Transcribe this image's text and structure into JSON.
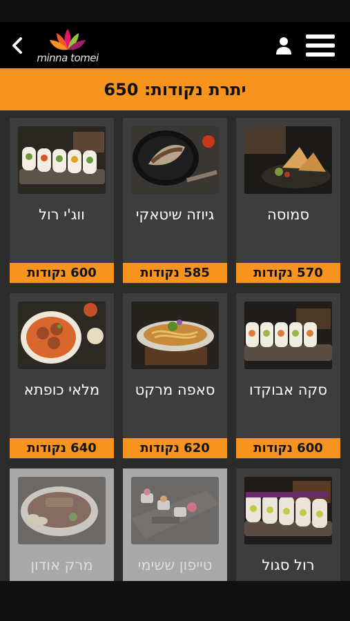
{
  "header": {
    "back_icon": "chevron-left-icon",
    "logo_text": "minna tomei",
    "profile_icon": "user-icon",
    "menu_icon": "hamburger-menu-icon"
  },
  "points": {
    "label": "יתרת נקודות: 650"
  },
  "items": [
    {
      "name": "סמוסה",
      "price": "570 נקודות",
      "available": true,
      "dish": "samosa"
    },
    {
      "name": "גיוזה שיטאקי",
      "price": "585 נקודות",
      "available": true,
      "dish": "gyoza"
    },
    {
      "name": "ווג'י רול",
      "price": "600 נקודות",
      "available": true,
      "dish": "veggie-roll"
    },
    {
      "name": "סקה אבוקדו",
      "price": "600 נקודות",
      "available": true,
      "dish": "avocado-roll"
    },
    {
      "name": "סאפה מרקט",
      "price": "620 נקודות",
      "available": true,
      "dish": "noodles"
    },
    {
      "name": "מלאי כופתא",
      "price": "640 נקודות",
      "available": true,
      "dish": "kofta"
    },
    {
      "name": "רול סגול",
      "price": "",
      "available": true,
      "dish": "purple-roll"
    },
    {
      "name": "טייפון ששימי",
      "price": "",
      "available": false,
      "dish": "sashimi"
    },
    {
      "name": "מרק אודון",
      "price": "",
      "available": false,
      "dish": "udon"
    }
  ],
  "colors": {
    "accent": "#f7941d",
    "card": "#3d3d3d",
    "card_disabled": "#a9a9a9",
    "background": "#2b2b2b"
  }
}
